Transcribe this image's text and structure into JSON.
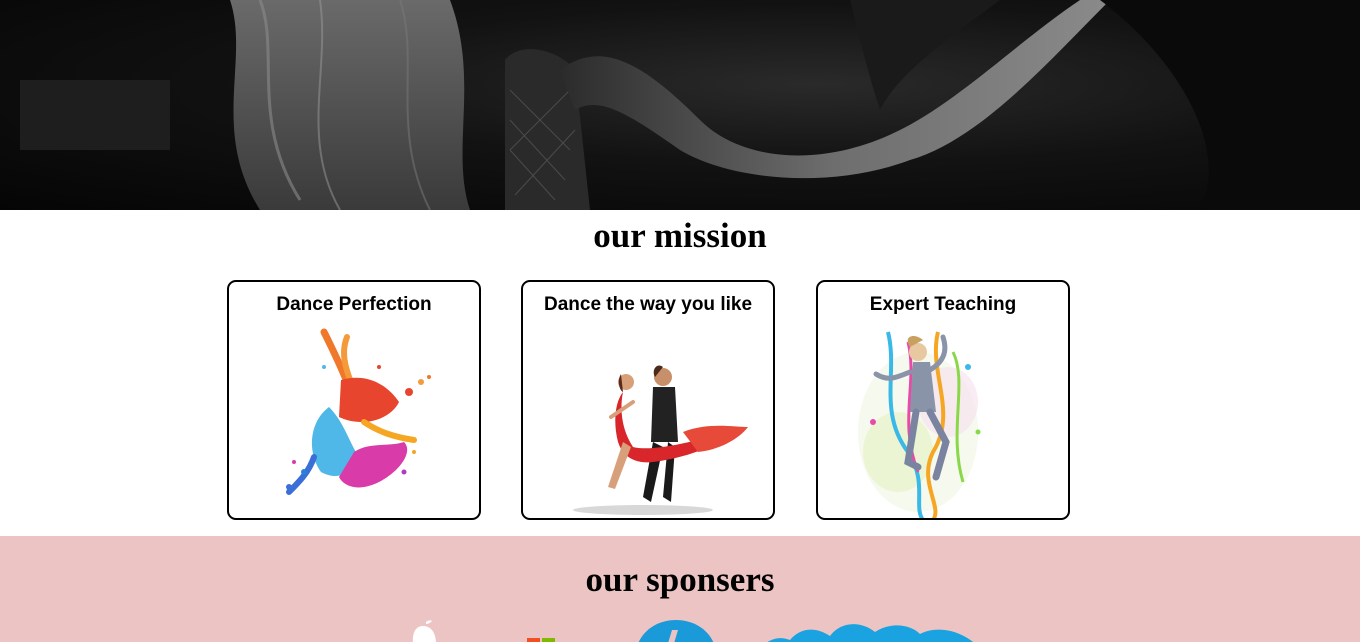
{
  "hero": {
    "image": "black-and-white-dancers-photo"
  },
  "mission": {
    "title": "our mission",
    "cards": [
      {
        "title": "Dance Perfection",
        "image": "colorful-paint-splash-dancer"
      },
      {
        "title": "Dance the way you like",
        "image": "tango-couple-red-dress"
      },
      {
        "title": "Expert Teaching",
        "image": "abstract-ribbon-dancer"
      }
    ]
  },
  "sponsors": {
    "title": "our sponsers",
    "background": "#ecc4c4",
    "logos": [
      "apple-logo",
      "microsoft-logo",
      "hp-logo",
      "skype-logo"
    ]
  }
}
